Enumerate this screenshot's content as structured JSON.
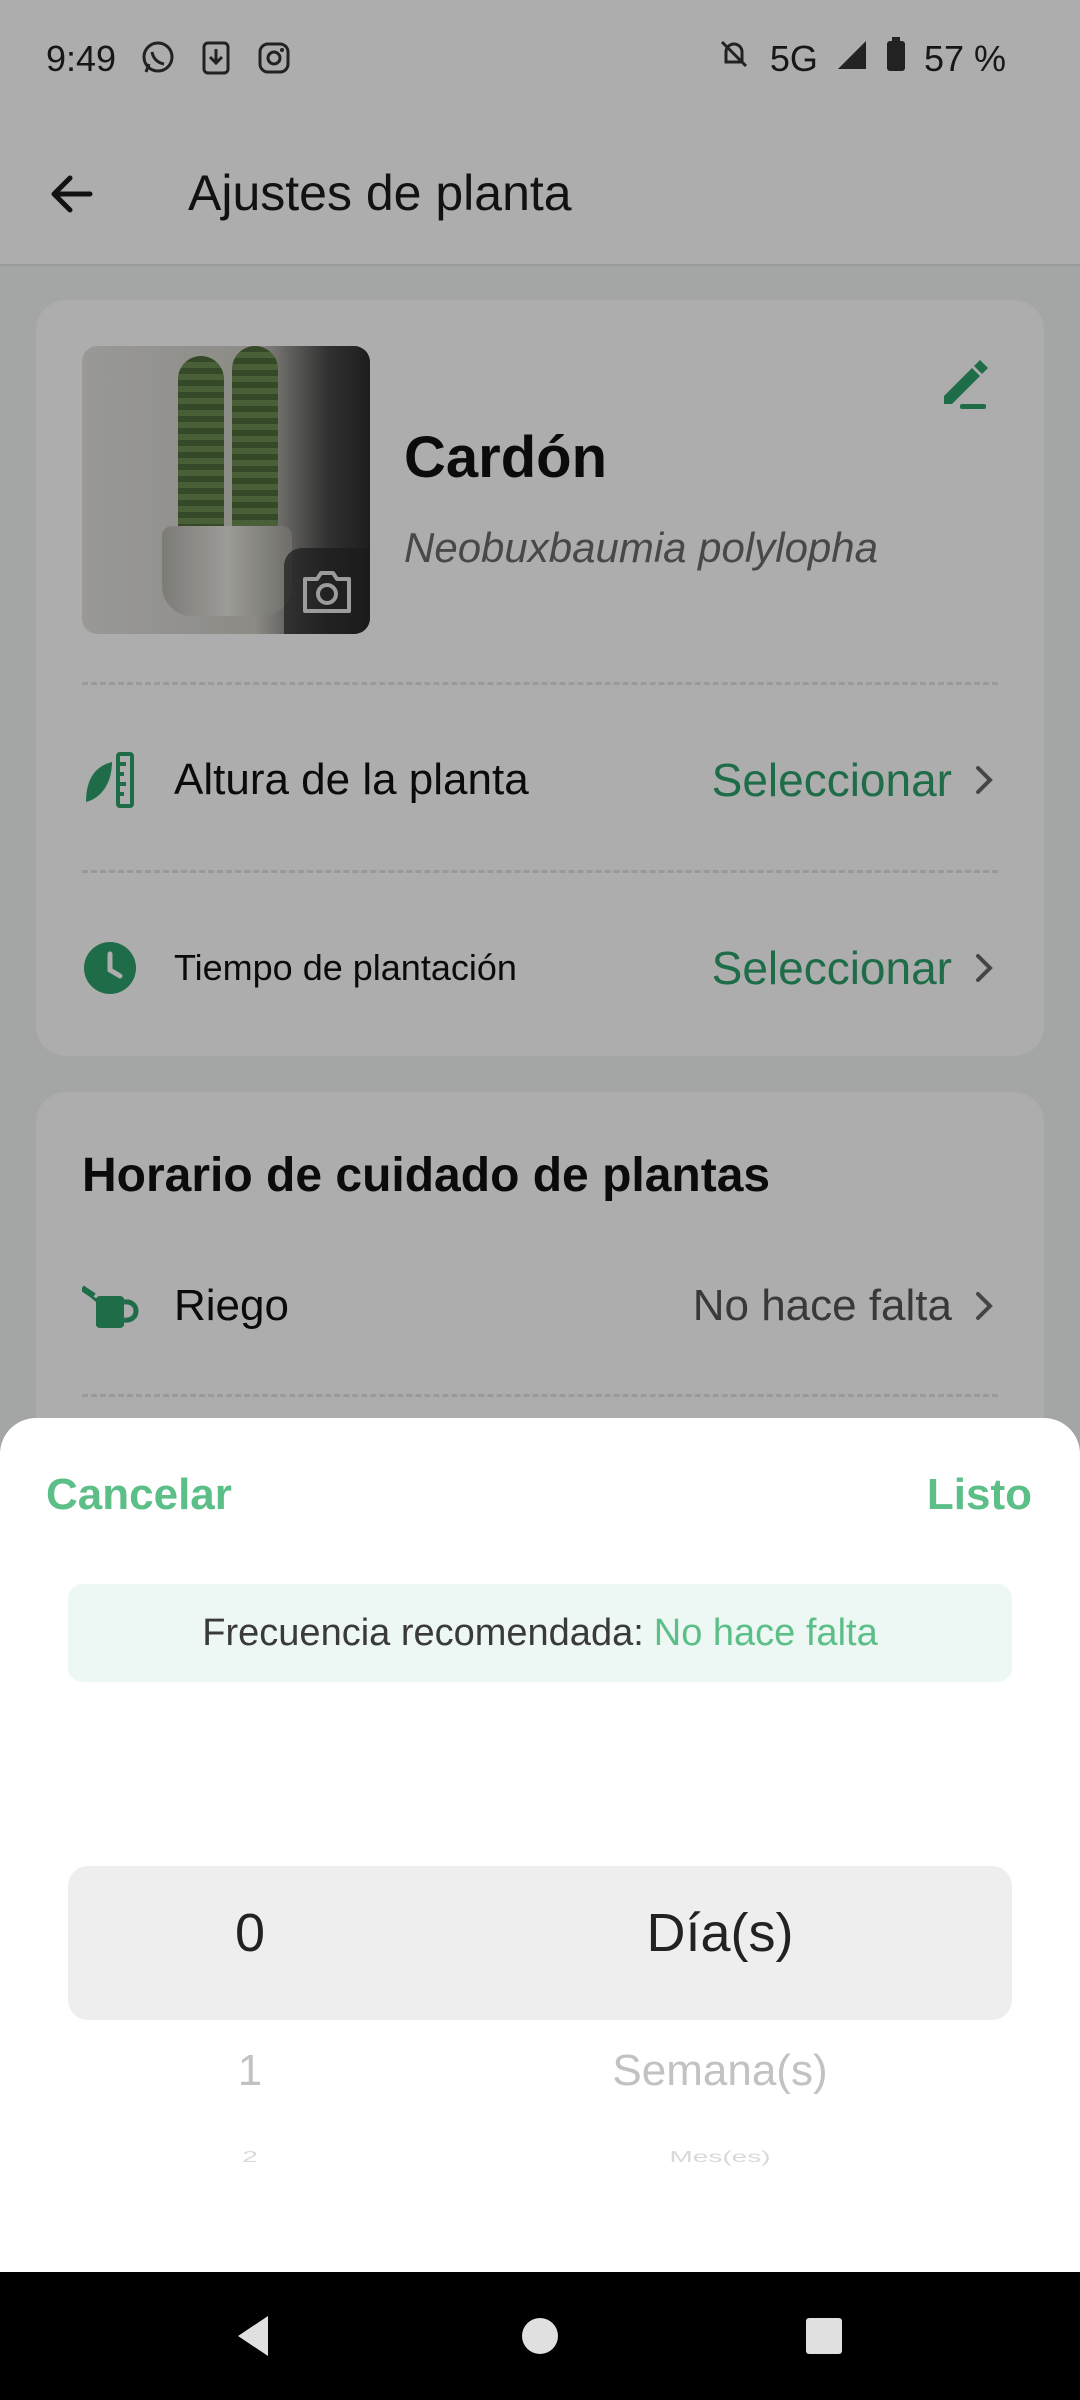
{
  "status_bar": {
    "time": "9:49",
    "network": "5G",
    "battery": "57 %",
    "left_icons": [
      "whatsapp-icon",
      "download-icon",
      "instagram-icon"
    ],
    "right_icons": [
      "notifications-off-icon",
      "signal-icon",
      "battery-icon"
    ]
  },
  "app_bar": {
    "title": "Ajustes de planta"
  },
  "plant": {
    "name": "Cardón",
    "scientific_name": "Neobuxbaumia polylopha"
  },
  "settings": {
    "height_label": "Altura de la planta",
    "height_value": "Seleccionar",
    "planting_label": "Tiempo de plantación",
    "planting_value": "Seleccionar"
  },
  "care": {
    "title": "Horario de cuidado de plantas",
    "watering_label": "Riego",
    "watering_value": "No hace falta"
  },
  "sheet": {
    "cancel": "Cancelar",
    "done": "Listo",
    "recommended_label": "Frecuencia recomendada:",
    "recommended_value": "No hace falta",
    "numbers": [
      "0",
      "1",
      "2"
    ],
    "units": [
      "Día(s)",
      "Semana(s)",
      "Mes(es)"
    ]
  },
  "colors": {
    "accent": "#5cbf88",
    "accent_dark": "#2f9f6a",
    "reco_bg": "#edf7f3"
  }
}
